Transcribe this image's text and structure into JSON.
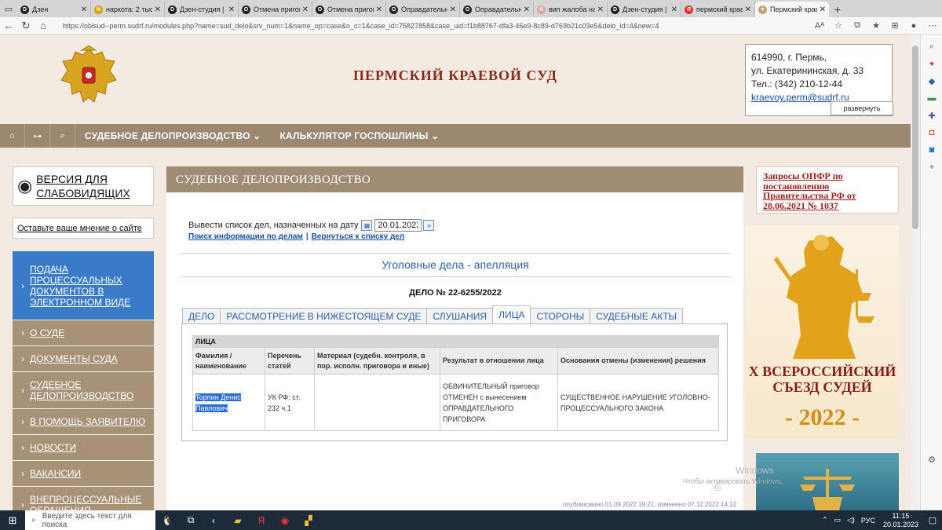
{
  "browser": {
    "tabs": [
      {
        "label": "Дзен",
        "fav_color": "#222",
        "fav_glyph": "D"
      },
      {
        "label": "наркота: 2 тыс",
        "fav_color": "#e0a000",
        "fav_glyph": "N"
      },
      {
        "label": "Дзен-студия | V",
        "fav_color": "#222",
        "fav_glyph": "D"
      },
      {
        "label": "Отмена пригов",
        "fav_color": "#222",
        "fav_glyph": "O"
      },
      {
        "label": "Отмена пригов",
        "fav_color": "#222",
        "fav_glyph": "O"
      },
      {
        "label": "Оправдательны",
        "fav_color": "#222",
        "fav_glyph": "O"
      },
      {
        "label": "Оправдательны",
        "fav_color": "#222",
        "fav_glyph": "O"
      },
      {
        "label": "вип жалоба на",
        "fav_color": "#e0a0a0",
        "fav_glyph": "Я"
      },
      {
        "label": "Дзен-студия | С",
        "fav_color": "#222",
        "fav_glyph": "D"
      },
      {
        "label": "пермский крае",
        "fav_color": "#e03030",
        "fav_glyph": "Я"
      },
      {
        "label": "Пермский крае",
        "fav_color": "#c8a070",
        "fav_glyph": "✦"
      }
    ],
    "url": "https://oblsud--perm.sudrf.ru/modules.php?name=sud_delo&srv_num=1&name_op=case&n_c=1&case_id=75827858&case_uid=f1b88767-dfa3-46e9-8c89-d769b21c03e5&delo_id=4&new=4"
  },
  "header": {
    "court_title": "ПЕРМСКИЙ КРАЕВОЙ СУД",
    "contacts": {
      "line1": "614990, г. Пермь,",
      "line2": "ул. Екатерининская, д. 33",
      "phone": "Тел.: (342) 210-12-44",
      "email": "kraevoy.perm@sudrf.ru"
    },
    "expand_label": "развернуть"
  },
  "mainnav": {
    "menu1": "СУДЕБНОЕ ДЕЛОПРОИЗВОДСТВО",
    "menu2": "КАЛЬКУЛЯТОР ГОСПОШЛИНЫ"
  },
  "left": {
    "visually_impaired": "ВЕРСИЯ ДЛЯ СЛАБОВИДЯЩИХ",
    "feedback": "Оставьте ваше мнение о сайте",
    "menu": [
      {
        "label": "ПОДАЧА ПРОЦЕССУАЛЬНЫХ ДОКУМЕНТОВ В ЭЛЕКТРОННОМ ВИДЕ"
      },
      {
        "label": "О СУДЕ"
      },
      {
        "label": "ДОКУМЕНТЫ СУДА"
      },
      {
        "label": "СУДЕБНОЕ ДЕЛОПРОИЗВОДСТВО"
      },
      {
        "label": "В ПОМОЩЬ ЗАЯВИТЕЛЮ"
      },
      {
        "label": "НОВОСТИ"
      },
      {
        "label": "ВАКАНСИИ"
      },
      {
        "label": "ВНЕПРОЦЕССУАЛЬНЫЕ ОБРАЩЕНИЯ"
      }
    ]
  },
  "panel": {
    "title": "СУДЕБНОЕ ДЕЛОПРОИЗВОДСТВО",
    "date_label": "Вывести список дел, назначенных на дату",
    "date_value": "20.01.2023",
    "link_search": "Поиск информации по делам",
    "link_back": "Вернуться к списку дел",
    "case_type": "Уголовные дела - апелляция",
    "case_number": "ДЕЛО № 22-6255/2022",
    "tabs": [
      "ДЕЛО",
      "РАССМОТРЕНИЕ В НИЖЕСТОЯЩЕМ СУДЕ",
      "СЛУШАНИЯ",
      "ЛИЦА",
      "СТОРОНЫ",
      "СУДЕБНЫЕ АКТЫ"
    ],
    "table": {
      "caption": "ЛИЦА",
      "headers": [
        "Фамилия / наименование",
        "Перечень статей",
        "Материал (судебн. контроля, в пор. исполн. приговора и иные)",
        "Результат в отношении лица",
        "Основания отмены (изменения) решения"
      ],
      "row": {
        "name": "Торпин Денис Павлович",
        "articles": "УК РФ: ст. 232 ч.1",
        "material": "",
        "result": "ОБВИНИТЕЛЬНЫЙ приговор ОТМЕНЕН с вынесением ОПРАВДАТЕЛЬНОГО ПРИГОВОРА",
        "grounds": "СУЩЕСТВЕННОЕ НАРУШЕНИЕ УГОЛОВНО-ПРОЦЕССУАЛЬНОГО ЗАКОНА"
      }
    },
    "published": "опубликовано 01.09.2022 19:21, изменено 07.12.2022 14:12"
  },
  "right": {
    "opfr": "Запросы ОПФР по постановлению Правительства РФ от 28.06.2021 № 1037",
    "banner_title": "X ВСЕРОССИЙСКИЙ СЪЕЗД СУДЕЙ",
    "banner_year": "- 2022 -",
    "watermark_big": "Windows",
    "watermark": "Чтобы активировать Windows,"
  },
  "taskbar": {
    "search_placeholder": "Введите здесь текст для поиска",
    "lang": "РУС",
    "time": "11:15",
    "date": "20.01.2023"
  }
}
